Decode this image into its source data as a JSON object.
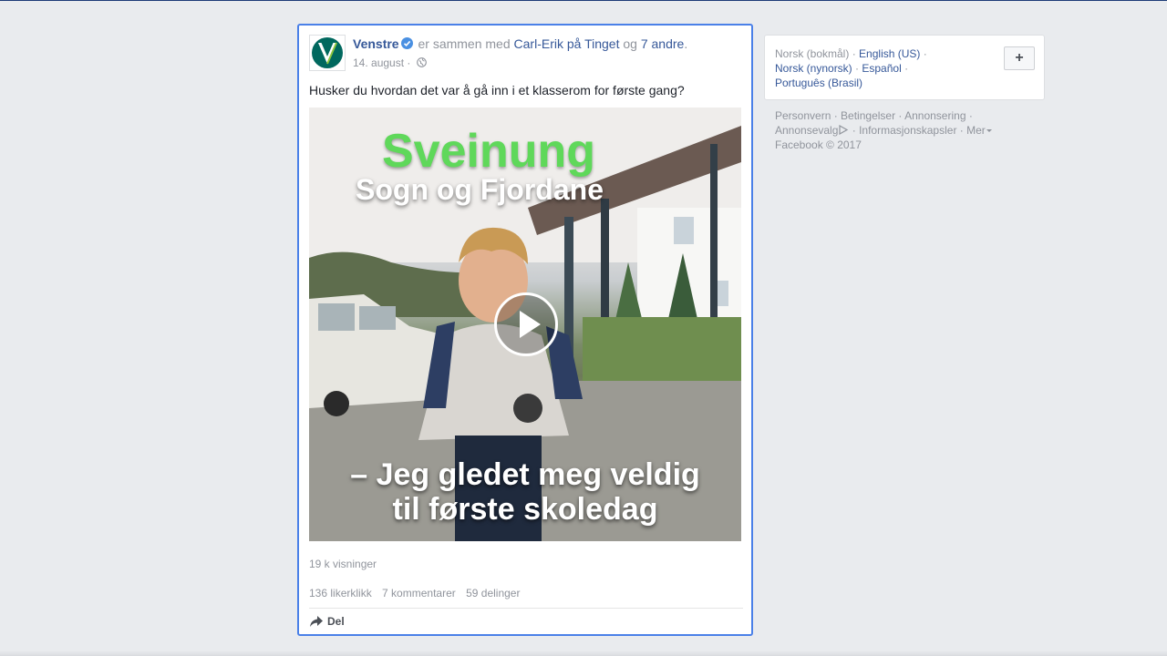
{
  "post": {
    "author": "Venstre",
    "with_text": "er sammen med",
    "tagged_person": "Carl-Erik på Tinget",
    "and_text": "og",
    "others": "7 andre",
    "period": ".",
    "date": "14. august",
    "separator": "·",
    "text": "Husker du hvordan det var å gå inn i et klasserom for første gang?",
    "video": {
      "overlay_name": "Sveinung",
      "overlay_region": "Sogn og Fjordane",
      "overlay_quote_line1": "– Jeg gledet meg veldig",
      "overlay_quote_line2": "til første skoledag"
    },
    "views": "19 k visninger",
    "likes": "136 likerklikk",
    "comments": "7 kommentarer",
    "shares": "59 delinger",
    "share_button": "Del"
  },
  "sidebar": {
    "languages": {
      "current": "Norsk (bokmål)",
      "sep": "·",
      "options": [
        "English (US)",
        "Norsk (nynorsk)",
        "Español",
        "Português (Brasil)"
      ],
      "add_button": "+"
    },
    "footer": {
      "links": [
        "Personvern",
        "Betingelser",
        "Annonsering",
        "Annonsevalg",
        "Informasjonskapsler",
        "Mer"
      ],
      "copyright": "Facebook © 2017"
    }
  },
  "colors": {
    "page_bg": "#e9ebee",
    "link": "#365899",
    "muted": "#90949c",
    "focus_border": "#4a80e8",
    "overlay_green": "#5fd85a"
  },
  "icons": [
    "venstre-logo-icon",
    "verified-badge-icon",
    "globe-icon",
    "play-icon",
    "share-arrow-icon",
    "adchoices-icon",
    "caret-down-icon"
  ]
}
